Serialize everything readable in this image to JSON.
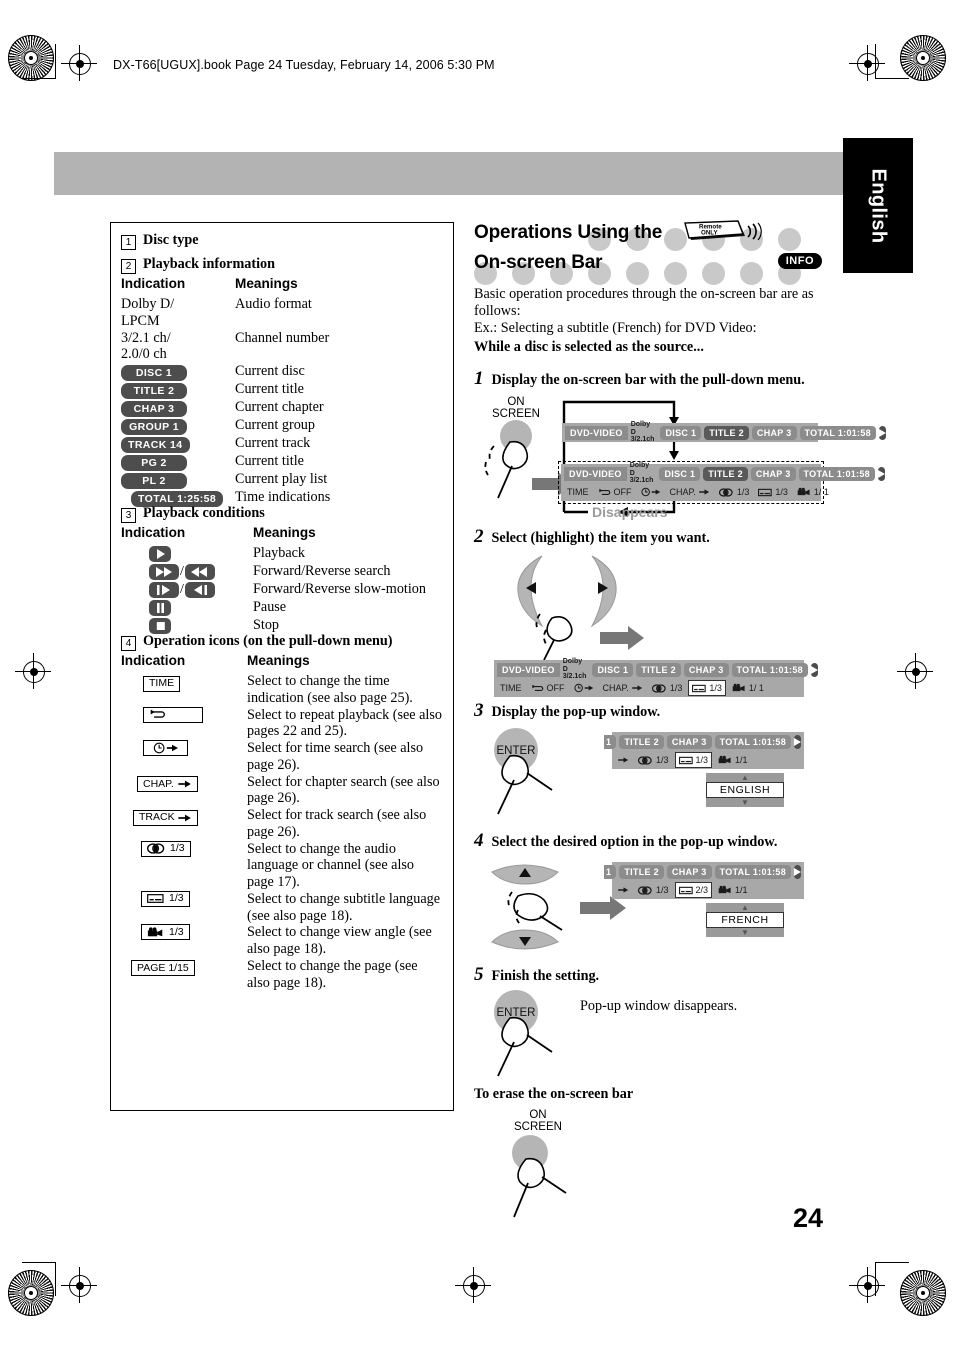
{
  "book_header": "DX-T66[UGUX].book  Page 24  Tuesday, February 14, 2006  5:30 PM",
  "language_tab": "English",
  "page_number": "24",
  "left_panel": {
    "sections": [
      {
        "num": "1",
        "title": "Disc type",
        "col_headers": null,
        "rows": []
      },
      {
        "num": "2",
        "title": "Playback information",
        "col_headers": {
          "indication": "Indication",
          "meanings": "Meanings"
        },
        "rows": [
          {
            "kind": "text",
            "indication": "Dolby D/\nLPCM",
            "meaning": "Audio format"
          },
          {
            "kind": "text",
            "indication": "3/2.1 ch/\n2.0/0 ch",
            "meaning": "Channel number"
          },
          {
            "kind": "chip",
            "indication": "DISC  1",
            "meaning": "Current disc"
          },
          {
            "kind": "chip",
            "indication": "TITLE  2",
            "meaning": "Current title"
          },
          {
            "kind": "chip",
            "indication": "CHAP  3",
            "meaning": "Current chapter"
          },
          {
            "kind": "chip",
            "indication": "GROUP 1",
            "meaning": "Current group"
          },
          {
            "kind": "chip",
            "indication": "TRACK 14",
            "meaning": "Current track"
          },
          {
            "kind": "chip",
            "indication": "PG     2",
            "meaning": "Current title"
          },
          {
            "kind": "chip",
            "indication": "PL     2",
            "meaning": "Current play list"
          },
          {
            "kind": "chip",
            "indication": "TOTAL 1:25:58",
            "meaning": "Time indications"
          }
        ]
      },
      {
        "num": "3",
        "title": "Playback conditions",
        "col_headers": {
          "indication": "Indication",
          "meanings": "Meanings"
        },
        "rows": [
          {
            "kind": "icon",
            "icon": "play-icon",
            "meaning": "Playback"
          },
          {
            "kind": "icon2",
            "icon_a": "fast-forward-icon",
            "icon_b": "rewind-icon",
            "meaning": "Forward/Reverse search"
          },
          {
            "kind": "icon2",
            "icon_a": "slow-forward-icon",
            "icon_b": "slow-reverse-icon",
            "meaning": "Forward/Reverse slow-motion"
          },
          {
            "kind": "icon",
            "icon": "pause-icon",
            "meaning": "Pause"
          },
          {
            "kind": "icon",
            "icon": "stop-icon",
            "meaning": "Stop"
          }
        ]
      },
      {
        "num": "4",
        "title": "Operation icons (on the pull-down menu)",
        "col_headers": {
          "indication": "Indication",
          "meanings": "Meanings"
        },
        "rows": [
          {
            "kind": "opbox",
            "label": "TIME",
            "meaning": "Select to change the time indication (see also page 25)."
          },
          {
            "kind": "opbox",
            "label": "",
            "icon": "repeat-icon",
            "meaning": "Select to repeat playback (see also pages 22 and 25)."
          },
          {
            "kind": "opbox",
            "label": "",
            "icon": "time-search-icon",
            "meaning": "Select for time search (see also page 26)."
          },
          {
            "kind": "opbox",
            "label": "CHAP.",
            "icon": "arrow-right-icon",
            "meaning": "Select for chapter search (see also page 26)."
          },
          {
            "kind": "opbox",
            "label": "TRACK",
            "icon": "arrow-right-icon",
            "meaning": "Select for track search (see also page 26)."
          },
          {
            "kind": "opbox",
            "label": "1/3",
            "icon": "audio-icon",
            "meaning": "Select to change the audio language or channel (see also page 17)."
          },
          {
            "kind": "opbox",
            "label": "1/3",
            "icon": "subtitle-icon",
            "meaning": "Select to change subtitle language (see also page 18)."
          },
          {
            "kind": "opbox",
            "label": "1/3",
            "icon": "angle-icon",
            "meaning": "Select to change view angle (see also page 18)."
          },
          {
            "kind": "opbox",
            "label": "PAGE 1/15",
            "meaning": "Select to change the page (see also page 18)."
          }
        ]
      }
    ]
  },
  "right_panel": {
    "heading_line1": "Operations Using the",
    "heading_line2": "On-screen Bar",
    "remote_badge_line1": "Remote",
    "remote_badge_line2": "ONLY",
    "info_badge": "INFO",
    "intro_line1": "Basic operation procedures through the on-screen bar are as",
    "intro_line2": "follows:",
    "intro_line3": "Ex.: Selecting a subtitle (French) for DVD Video:",
    "intro_bold": "While a disc is selected as the source...",
    "steps": [
      {
        "num": "1",
        "text": "Display the on-screen bar with the pull-down menu."
      },
      {
        "num": "2",
        "text": "Select (highlight) the item you want."
      },
      {
        "num": "3",
        "text": "Display the pop-up window."
      },
      {
        "num": "4",
        "text": "Select the desired option in the pop-up window."
      },
      {
        "num": "5",
        "text": "Finish the setting."
      }
    ],
    "button_on_screen_l1": "ON",
    "button_on_screen_l2": "SCREEN",
    "button_enter": "ENTER",
    "disappears_label": "Disappears",
    "popup_disappears_note": "Pop-up window disappears.",
    "erase_heading": "To erase the on-screen bar",
    "osd_bar": {
      "disc_type": "DVD-VIDEO",
      "audio_format_l1": "Dolby D",
      "audio_format_l2": "3/2.1ch",
      "disc": "DISC 1",
      "title": "TITLE  2",
      "chapter": "CHAP  3",
      "total": "TOTAL  1:01:58",
      "menu_time": "TIME",
      "menu_repeat": "OFF",
      "menu_time_search": "",
      "menu_chapter": "CHAP.",
      "menu_audio": "1/3",
      "menu_subtitle_step1": "1/3",
      "menu_subtitle_step4": "2/3",
      "menu_angle": "1/ 1",
      "menu_angle_alt": "1/1"
    },
    "popup_english": "ENGLISH",
    "popup_french": "FRENCH"
  }
}
